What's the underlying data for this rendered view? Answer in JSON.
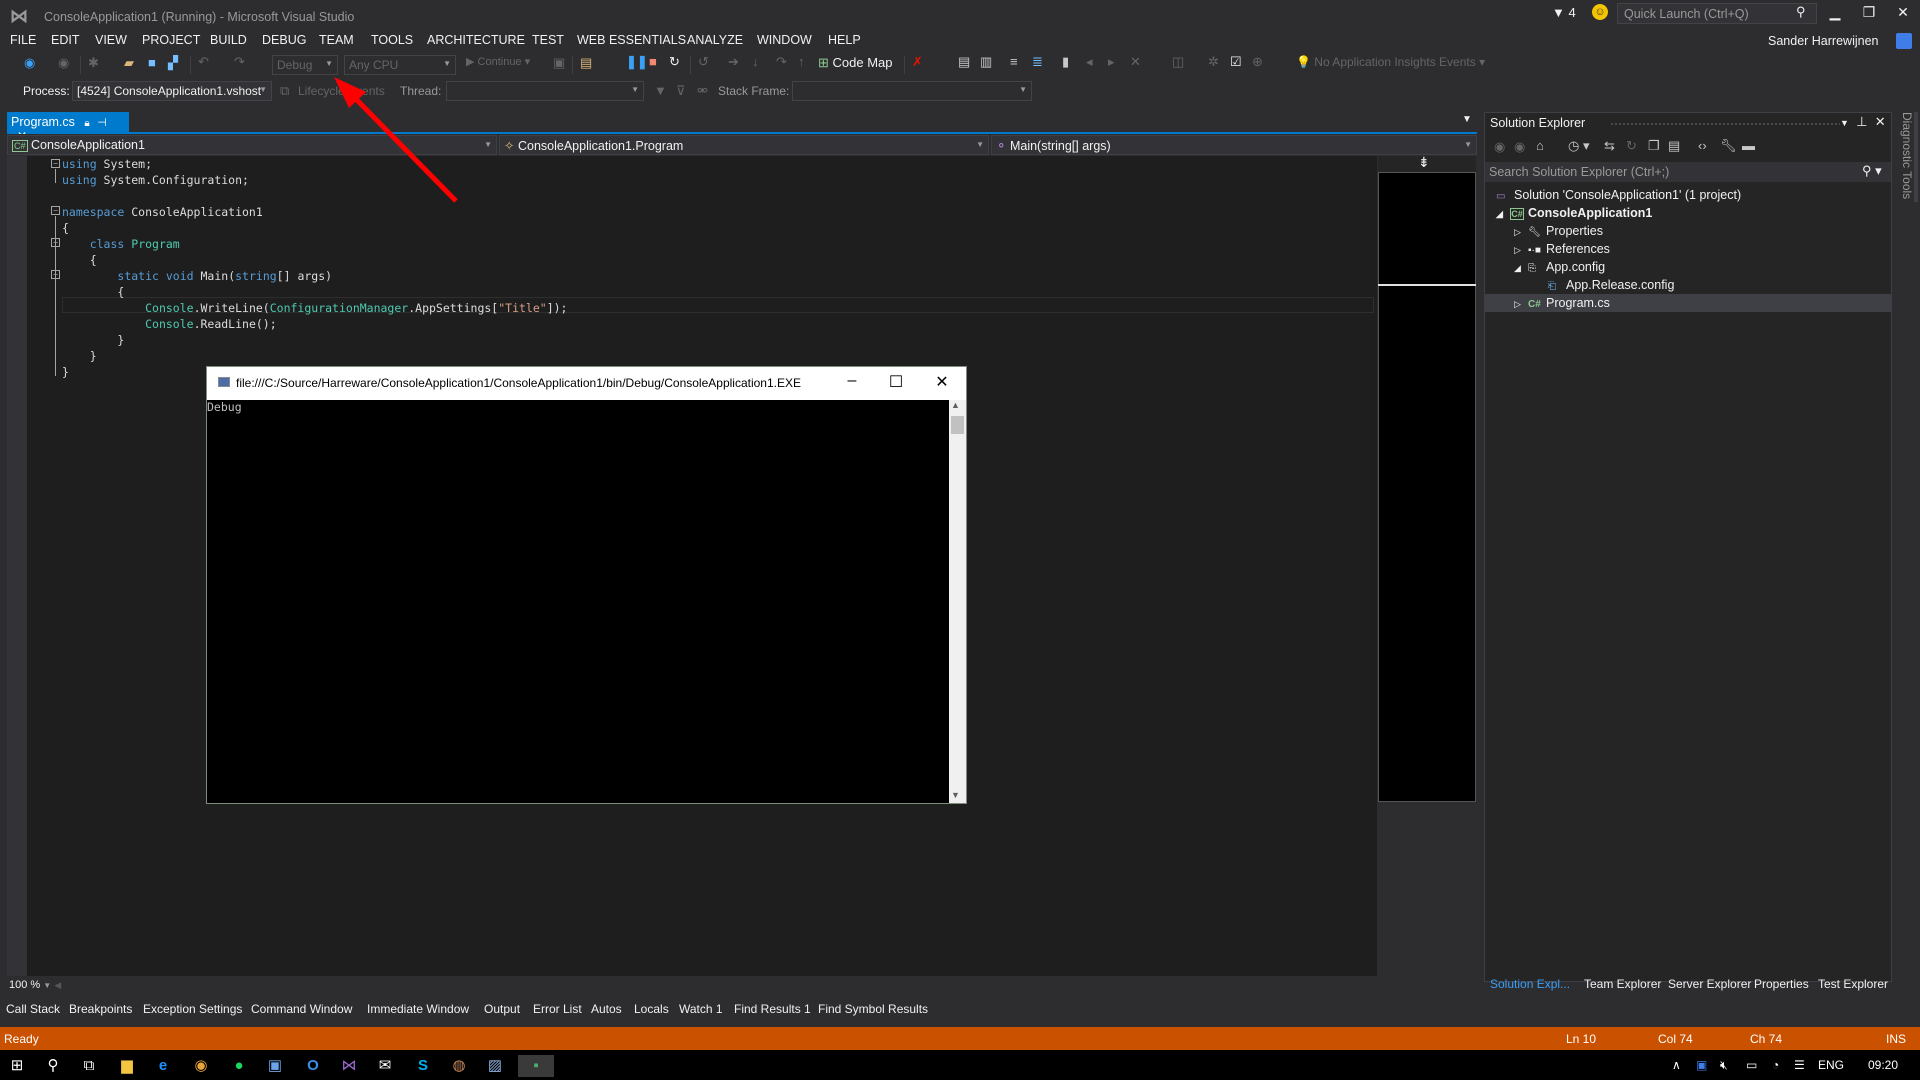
{
  "window": {
    "title": "ConsoleApplication1 (Running) - Microsoft Visual Studio",
    "notification_count": "4",
    "quick_launch_placeholder": "Quick Launch (Ctrl+Q)",
    "user_name": "Sander Harrewijnen",
    "controls": {
      "minimize": "▁",
      "restore": "❐",
      "close": "✕"
    }
  },
  "menu": [
    "FILE",
    "EDIT",
    "VIEW",
    "PROJECT",
    "BUILD",
    "DEBUG",
    "TEAM",
    "TOOLS",
    "ARCHITECTURE",
    "TEST",
    "WEB ESSENTIALS",
    "ANALYZE",
    "WINDOW",
    "HELP"
  ],
  "toolbar": {
    "configuration": "Debug",
    "platform": "Any CPU",
    "continue_label": "Continue",
    "code_map_label": "Code Map",
    "insights_label": "No Application Insights Events"
  },
  "debug_location": {
    "process_label": "Process:",
    "process_value": "[4524] ConsoleApplication1.vshost",
    "lifecycle_label": "Lifecycle Events",
    "thread_label": "Thread:",
    "stack_frame_label": "Stack Frame:"
  },
  "document": {
    "tab_label": "Program.cs",
    "nav_project": "ConsoleApplication1",
    "nav_type": "ConsoleApplication1.Program",
    "nav_member": "Main(string[] args)",
    "zoom": "100 %",
    "code_lines": [
      "using System;",
      "using System.Configuration;",
      "",
      "namespace ConsoleApplication1",
      "{",
      "    class Program",
      "    {",
      "        static void Main(string[] args)",
      "        {",
      "            Console.WriteLine(ConfigurationManager.AppSettings[\"Title\"]);",
      "            Console.ReadLine();",
      "        }",
      "    }",
      "}"
    ],
    "current_line": 10
  },
  "console": {
    "title": "file:///C:/Source/Harreware/ConsoleApplication1/ConsoleApplication1/bin/Debug/ConsoleApplication1.EXE",
    "output": "Debug"
  },
  "solution_explorer": {
    "title": "Solution Explorer",
    "search_placeholder": "Search Solution Explorer (Ctrl+;)",
    "items": [
      {
        "label": "Solution 'ConsoleApplication1' (1 project)",
        "icon": "solution-icon",
        "level": 0
      },
      {
        "label": "ConsoleApplication1",
        "icon": "csharp-project-icon",
        "level": 1,
        "expanded": true,
        "bold": true
      },
      {
        "label": "Properties",
        "icon": "wrench-icon",
        "level": 2,
        "expanded": false
      },
      {
        "label": "References",
        "icon": "references-icon",
        "level": 2,
        "expanded": false
      },
      {
        "label": "App.config",
        "icon": "config-icon",
        "level": 2,
        "expanded": true
      },
      {
        "label": "App.Release.config",
        "icon": "transform-config-icon",
        "level": 3
      },
      {
        "label": "Program.cs",
        "icon": "csharp-file-icon",
        "level": 2,
        "expanded": false,
        "selected": true
      }
    ],
    "tabs": [
      "Solution Expl...",
      "Team Explorer",
      "Server Explorer",
      "Properties",
      "Test Explorer"
    ],
    "side_tab": "Diagnostic Tools"
  },
  "bottom_tabs": [
    "Call Stack",
    "Breakpoints",
    "Exception Settings",
    "Command Window",
    "Immediate Window",
    "Output",
    "Error List",
    "Autos",
    "Locals",
    "Watch 1",
    "Find Results 1",
    "Find Symbol Results"
  ],
  "status": {
    "message": "Ready",
    "line": "Ln 10",
    "col": "Col 74",
    "ch": "Ch 74",
    "mode": "INS"
  },
  "taskbar": {
    "apps": [
      "start-icon",
      "search-icon",
      "task-view-icon",
      "file-explorer-icon",
      "edge-icon",
      "chrome-icon",
      "spotify-icon",
      "remote-desktop-icon",
      "outlook-icon",
      "visual-studio-icon",
      "mail-icon",
      "skype-icon",
      "app-icon",
      "app2-icon",
      "console-icon"
    ],
    "language": "ENG",
    "time": "09:20"
  },
  "colors": {
    "accent": "#007acc",
    "status_bar_debugging": "#ca5100",
    "annotation_arrow": "#ff0000"
  }
}
